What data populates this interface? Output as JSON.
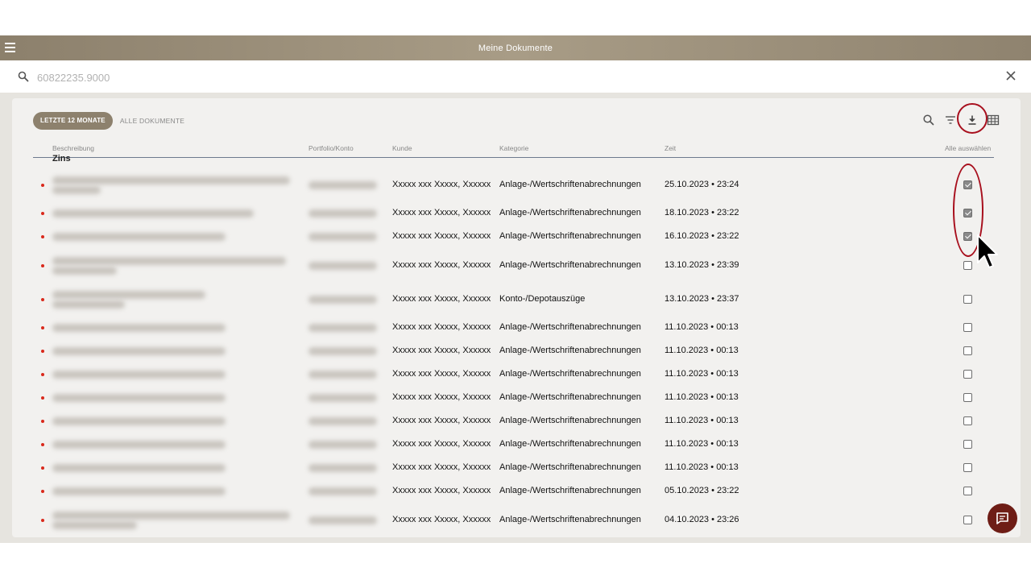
{
  "app": {
    "title": "Meine Dokumente"
  },
  "search": {
    "placeholder": "60822235.9000"
  },
  "tabs": [
    {
      "label": "LETZTE 12 MONATE",
      "active": true
    },
    {
      "label": "ALLE DOKUMENTE",
      "active": false
    }
  ],
  "columns": {
    "beschreibung": "Beschreibung",
    "portfolio": "Portfolio/Konto",
    "kunde": "Kunde",
    "kategorie": "Kategorie",
    "zeit": "Zeit",
    "alle": "Alle auswählen"
  },
  "cutoff_label": "Zins",
  "rows": [
    {
      "kunde": "Xxxxx xxx Xxxxx, Xxxxxx",
      "kategorie": "Anlage-/Wertschriftenabrechnungen",
      "zeit": "25.10.2023 • 23:24",
      "checked": true
    },
    {
      "kunde": "Xxxxx xxx Xxxxx, Xxxxxx",
      "kategorie": "Anlage-/Wertschriftenabrechnungen",
      "zeit": "18.10.2023 • 23:22",
      "checked": true
    },
    {
      "kunde": "Xxxxx xxx Xxxxx, Xxxxxx",
      "kategorie": "Anlage-/Wertschriftenabrechnungen",
      "zeit": "16.10.2023 • 23:22",
      "checked": true
    },
    {
      "kunde": "Xxxxx xxx Xxxxx, Xxxxxx",
      "kategorie": "Anlage-/Wertschriftenabrechnungen",
      "zeit": "13.10.2023 • 23:39",
      "checked": false
    },
    {
      "kunde": "Xxxxx xxx Xxxxx, Xxxxxx",
      "kategorie": "Konto-/Depotauszüge",
      "zeit": "13.10.2023 • 23:37",
      "checked": false
    },
    {
      "kunde": "Xxxxx xxx Xxxxx, Xxxxxx",
      "kategorie": "Anlage-/Wertschriftenabrechnungen",
      "zeit": "11.10.2023 • 00:13",
      "checked": false
    },
    {
      "kunde": "Xxxxx xxx Xxxxx, Xxxxxx",
      "kategorie": "Anlage-/Wertschriftenabrechnungen",
      "zeit": "11.10.2023 • 00:13",
      "checked": false
    },
    {
      "kunde": "Xxxxx xxx Xxxxx, Xxxxxx",
      "kategorie": "Anlage-/Wertschriftenabrechnungen",
      "zeit": "11.10.2023 • 00:13",
      "checked": false
    },
    {
      "kunde": "Xxxxx xxx Xxxxx, Xxxxxx",
      "kategorie": "Anlage-/Wertschriftenabrechnungen",
      "zeit": "11.10.2023 • 00:13",
      "checked": false
    },
    {
      "kunde": "Xxxxx xxx Xxxxx, Xxxxxx",
      "kategorie": "Anlage-/Wertschriftenabrechnungen",
      "zeit": "11.10.2023 • 00:13",
      "checked": false
    },
    {
      "kunde": "Xxxxx xxx Xxxxx, Xxxxxx",
      "kategorie": "Anlage-/Wertschriftenabrechnungen",
      "zeit": "11.10.2023 • 00:13",
      "checked": false
    },
    {
      "kunde": "Xxxxx xxx Xxxxx, Xxxxxx",
      "kategorie": "Anlage-/Wertschriftenabrechnungen",
      "zeit": "11.10.2023 • 00:13",
      "checked": false
    },
    {
      "kunde": "Xxxxx xxx Xxxxx, Xxxxxx",
      "kategorie": "Anlage-/Wertschriftenabrechnungen",
      "zeit": "05.10.2023 • 23:22",
      "checked": false
    },
    {
      "kunde": "Xxxxx xxx Xxxxx, Xxxxxx",
      "kategorie": "Anlage-/Wertschriftenabrechnungen",
      "zeit": "04.10.2023 • 23:26",
      "checked": false
    }
  ],
  "icons": {
    "menu": "hamburger-menu-icon",
    "search": "search-icon",
    "close": "close-icon",
    "filter": "filter-icon",
    "download": "download-icon",
    "grid": "grid-view-icon",
    "chat": "chat-icon",
    "cursor": "mouse-pointer-icon"
  },
  "colors": {
    "header": "#9a8e78",
    "tab_active": "#8d816d",
    "bullet": "#d9291c",
    "annotation": "#a8101e",
    "chat_button": "#6e1d16"
  }
}
